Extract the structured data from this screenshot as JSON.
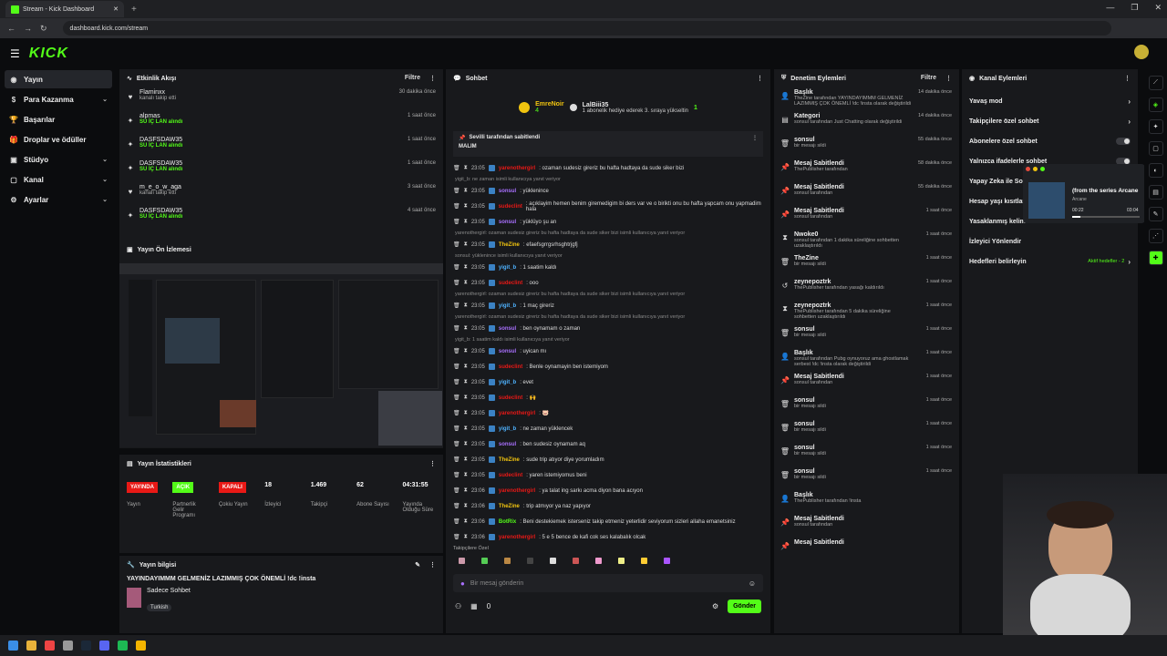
{
  "browser": {
    "tab_title": "Stream - Kick Dashboard",
    "url": "dashboard.kick.com/stream"
  },
  "logo": "KICK",
  "sidebar": {
    "items": [
      {
        "label": "Yayın",
        "icon": "broadcast-icon"
      },
      {
        "label": "Para Kazanma",
        "icon": "money-icon"
      },
      {
        "label": "Başarılar",
        "icon": "trophy-icon"
      },
      {
        "label": "Droplar ve ödüller",
        "icon": "gift-icon"
      },
      {
        "label": "Stüdyo",
        "icon": "studio-icon"
      },
      {
        "label": "Kanal",
        "icon": "channel-icon"
      },
      {
        "label": "Ayarlar",
        "icon": "gear-icon"
      }
    ]
  },
  "activity": {
    "title": "Etkinlik Akışı",
    "filter": "Filtre",
    "items": [
      {
        "user": "Flaminxx",
        "sub": "kanalı takip etti",
        "time": "30 dakika önce",
        "type": "heart"
      },
      {
        "user": "alpmas",
        "sub": "SU İÇ LAN alındı",
        "time": "1 saat önce",
        "type": "gift"
      },
      {
        "user": "DASFSDAW35",
        "sub": "SU İÇ LAN alındı",
        "time": "1 saat önce",
        "type": "gift"
      },
      {
        "user": "DASFSDAW35",
        "sub": "SU İÇ LAN alındı",
        "time": "1 saat önce",
        "type": "gift"
      },
      {
        "user": "m_e_o_w_aga",
        "sub": "kanalı takip etti",
        "time": "3 saat önce",
        "type": "heart"
      },
      {
        "user": "DASFSDAW35",
        "sub": "SU İÇ LAN alındı",
        "time": "4 saat önce",
        "type": "gift"
      }
    ]
  },
  "preview": {
    "title": "Yayın Ön İzlemesi"
  },
  "stats": {
    "title": "Yayın İstatistikleri",
    "items": [
      {
        "value": "YAYINDA",
        "label": "Yayın",
        "badge": "#e91916"
      },
      {
        "value": "AÇIK",
        "label": "Partnerlik Gelir Programı",
        "badge": "#53fc18"
      },
      {
        "value": "KAPALI",
        "label": "Çokiu Yayın",
        "badge": "#e91916"
      },
      {
        "value": "18",
        "label": "İzleyici"
      },
      {
        "value": "1.469",
        "label": "Takipçi"
      },
      {
        "value": "62",
        "label": "Abone Sayısı"
      },
      {
        "value": "04:31:55",
        "label": "Yayında Olduğu Süre"
      }
    ]
  },
  "info": {
    "title": "Yayın bilgisi",
    "stream_title": "YAYINDAYIMMM GELMENİZ LAZIMMIŞ ÇOK ÖNEMLİ !dc !insta",
    "category": "Sadece Sohbet",
    "tag": "Turkish"
  },
  "chat": {
    "title": "Sohbet",
    "gifter": "EmreNoir",
    "gifter_count": "4",
    "gift_user": "LalBiii35",
    "gift_num": "1",
    "gift_text": "1 abonelik hediye ederek 3. sıraya yükseltin",
    "pinned_by": "Sevilli tarafından sabitlendi",
    "pinned_text": "MALIM",
    "messages": [
      {
        "reply": "",
        "time": "23:05",
        "user": "yarenothergirl",
        "color": "#e91916",
        "text": ": ozaman sudesiz gireriz bu hafta hadtaya da sude siker bizi"
      },
      {
        "reply": "yigit_b: ne zaman isimli kullanıcıya yanıt veriyor",
        "time": "23:05",
        "user": "sonsul",
        "color": "#a970ff",
        "text": ": yüklenince"
      },
      {
        "reply": "",
        "time": "23:05",
        "user": "sudeclint",
        "color": "#e91916",
        "text": ": açıklayim hemen benim giremedigim bi ders var ve o birikti onu bu hafta yapcam onu yapmadim hala"
      },
      {
        "reply": "",
        "time": "23:05",
        "user": "sonsul",
        "color": "#a970ff",
        "text": ": yüklüyo şu an"
      },
      {
        "reply": "yarenothergirl: ozaman sudesiz gireriz bu hafta hadtaya da sude siker bizi isimli kullanıcıya yanıt veriyor",
        "time": "23:05",
        "user": "TheZine",
        "color": "#f1c40f",
        "text": ": efaefsgrrgsrhsghtrjgfj"
      },
      {
        "reply": "sonsul: yüklenince isimli kullanıcıya yanıt veriyor",
        "time": "23:05",
        "user": "yigit_b",
        "color": "#4fb3ff",
        "text": ": 1 saatim kaldı"
      },
      {
        "reply": "",
        "time": "23:05",
        "user": "sudeclint",
        "color": "#e91916",
        "text": ": ooo"
      },
      {
        "reply": "yarenothergirl: ozaman sudesiz gireriz bu hafta hadtaya da sude siker bizi isimli kullanıcıya yanıt veriyor",
        "time": "23:05",
        "user": "yigit_b",
        "color": "#4fb3ff",
        "text": ": 1 maç gireriz"
      },
      {
        "reply": "yarenothergirl: ozaman sudesiz gireriz bu hafta hadtaya da sude siker bizi isimli kullanıcıya yanıt veriyor",
        "time": "23:05",
        "user": "sonsul",
        "color": "#a970ff",
        "text": ": ben oynamam o zaman"
      },
      {
        "reply": "yigit_b: 1 saatim kaldı isimli kullanıcıya yanıt veriyor",
        "time": "23:05",
        "user": "sonsul",
        "color": "#a970ff",
        "text": ": uyican mı"
      },
      {
        "reply": "",
        "time": "23:05",
        "user": "sudeclint",
        "color": "#e91916",
        "text": ": Benle oynamayin ben istemiyom"
      },
      {
        "reply": "",
        "time": "23:05",
        "user": "yigit_b",
        "color": "#4fb3ff",
        "text": ": evet"
      },
      {
        "reply": "",
        "time": "23:05",
        "user": "sudeclint",
        "color": "#e91916",
        "text": ": 🙌"
      },
      {
        "reply": "",
        "time": "23:05",
        "user": "yarenothergirl",
        "color": "#e91916",
        "text": ": 🐷"
      },
      {
        "reply": "",
        "time": "23:05",
        "user": "yigit_b",
        "color": "#4fb3ff",
        "text": ": ne zaman yüklencek"
      },
      {
        "reply": "",
        "time": "23:05",
        "user": "sonsul",
        "color": "#a970ff",
        "text": ": ben sudesiz oynamam aq"
      },
      {
        "reply": "",
        "time": "23:05",
        "user": "TheZine",
        "color": "#f1c40f",
        "text": ": sude trip atıyor diye yorumladım"
      },
      {
        "reply": "",
        "time": "23:05",
        "user": "sudeclint",
        "color": "#e91916",
        "text": ": yaren istemiyomus beni"
      },
      {
        "reply": "",
        "time": "23:06",
        "user": "yarenothergirl",
        "color": "#e91916",
        "text": ": ya talat ing sarkı acma diyon bana acıyon"
      },
      {
        "reply": "",
        "time": "23:06",
        "user": "TheZine",
        "color": "#f1c40f",
        "text": ": trip atmıyor ya naz yapıyor"
      },
      {
        "reply": "",
        "time": "23:06",
        "user": "BotRix",
        "color": "#53fc18",
        "text": ": Beni destekiemek isterseniz takip etmeniz yeterlidir seviyorum sizleri allaha emanetsiniz"
      },
      {
        "reply": "",
        "time": "23:06",
        "user": "yarenothergirl",
        "color": "#e91916",
        "text": ": 5 e 5 bence de kafi cok ses kalabalık olcak"
      }
    ],
    "emotes_label": "Takipçilere Özel",
    "placeholder": "Bir mesaj gönderin",
    "send": "Gönder",
    "points": "0"
  },
  "mod": {
    "title": "Denetim Eylemleri",
    "filter": "Filtre",
    "items": [
      {
        "user": "Başlık",
        "sub": "TheZine tarafından YAYINDAYIMMM GELMENİZ LAZIMMIŞ ÇOK ÖNEMLİ !dc !insta olarak değiştirildi",
        "time": "14 dakika önce",
        "icon": "user-icon"
      },
      {
        "user": "Kategori",
        "sub": "sonsul tarafından Just Chatting olarak değiştirildi",
        "time": "14 dakika önce",
        "icon": "category-icon"
      },
      {
        "user": "sonsul",
        "sub": "bir mesajı sildi",
        "time": "55 dakika önce",
        "icon": "trash-icon"
      },
      {
        "user": "Mesaj Sabitlendi",
        "sub": "ThePublisher tarafından",
        "time": "58 dakika önce",
        "icon": "pin-icon"
      },
      {
        "user": "Mesaj Sabitlendi",
        "sub": "sonsul tarafından",
        "time": "55 dakika önce",
        "icon": "pin-icon"
      },
      {
        "user": "Mesaj Sabitlendi",
        "sub": "sonsul tarafından",
        "time": "1 saat önce",
        "icon": "pin-icon"
      },
      {
        "user": "Nwoke0",
        "sub": "sonsul tarafından 1 dakika süreliğine sohbetten uzaklaştırıldı",
        "time": "1 saat önce",
        "icon": "hourglass-icon"
      },
      {
        "user": "TheZine",
        "sub": "bir mesajı sildi",
        "time": "1 saat önce",
        "icon": "trash-icon"
      },
      {
        "user": "zeynepoztrk",
        "sub": "ThePublisher tarafından yasağı kaldırıldı",
        "time": "1 saat önce",
        "icon": "undo-icon"
      },
      {
        "user": "zeynepoztrk",
        "sub": "ThePublisher tarafından 5 dakika süreliğine sohbetten uzaklaştırıldı",
        "time": "1 saat önce",
        "icon": "hourglass-icon"
      },
      {
        "user": "sonsul",
        "sub": "bir mesajı sildi",
        "time": "1 saat önce",
        "icon": "trash-icon"
      },
      {
        "user": "Başlık",
        "sub": "sonsul tarafından Pubg oynuyoruz ama ghostlamak serbest !dc !insta olarak değiştirildi",
        "time": "1 saat önce",
        "icon": "user-icon"
      },
      {
        "user": "Mesaj Sabitlendi",
        "sub": "sonsul tarafından",
        "time": "1 saat önce",
        "icon": "pin-icon"
      },
      {
        "user": "sonsul",
        "sub": "bir mesajı sildi",
        "time": "1 saat önce",
        "icon": "trash-icon"
      },
      {
        "user": "sonsul",
        "sub": "bir mesajı sildi",
        "time": "1 saat önce",
        "icon": "trash-icon"
      },
      {
        "user": "sonsul",
        "sub": "bir mesajı sildi",
        "time": "1 saat önce",
        "icon": "trash-icon"
      },
      {
        "user": "sonsul",
        "sub": "bir mesajı sildi",
        "time": "1 saat önce",
        "icon": "trash-icon"
      },
      {
        "user": "Başlık",
        "sub": "ThePublisher tarafından !insta",
        "time": "",
        "icon": "user-icon"
      },
      {
        "user": "Mesaj Sabitlendi",
        "sub": "sonsul tarafından",
        "time": "",
        "icon": "pin-icon"
      },
      {
        "user": "Mesaj Sabitlendi",
        "sub": "",
        "time": "",
        "icon": "pin-icon"
      }
    ]
  },
  "actions": {
    "title": "Kanal Eylemleri",
    "items": [
      {
        "label": "Yavaş mod",
        "ctrl": "chevron"
      },
      {
        "label": "Takipçilere özel sohbet",
        "ctrl": "chevron"
      },
      {
        "label": "Abonelere özel sohbet",
        "ctrl": "toggle"
      },
      {
        "label": "Yalnızca ifadelerle sohbet",
        "ctrl": "toggle"
      },
      {
        "label": "Yapay Zeka ile Sohbet",
        "ctrl": ""
      },
      {
        "label": "Hesap yaşı kısıtlaması",
        "ctrl": ""
      },
      {
        "label": "Yasaklanmış kelimeler",
        "ctrl": ""
      },
      {
        "label": "İzleyici Yönlendir",
        "ctrl": ""
      },
      {
        "label": "Hedefleri belirleyin",
        "ctrl": "chevron",
        "extra": "Aktif hedefler - 2"
      }
    ]
  },
  "media": {
    "title": "(from the series Arcane",
    "artist": "Arcane",
    "elapsed": "00:22",
    "total": "03:04",
    "progress": 0.12
  }
}
